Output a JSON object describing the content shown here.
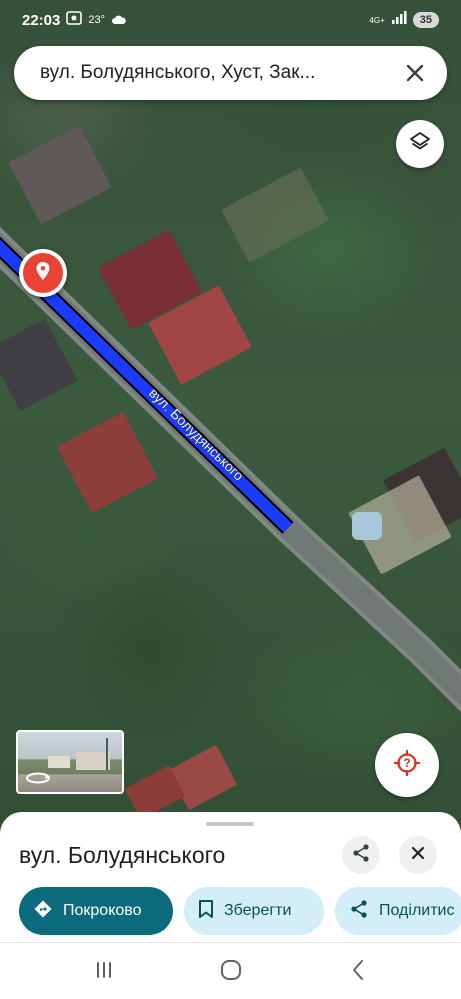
{
  "status_bar": {
    "time": "22:03",
    "temperature": "23°",
    "network": "4G+",
    "battery": "35"
  },
  "search": {
    "query": "вул. Болудянського, Хуст, Зак..."
  },
  "map": {
    "street_label": "вул. Болудянського",
    "route_color": "#1a3cff",
    "pin_color": "#ea4335"
  },
  "sheet": {
    "title": "вул. Болудянського",
    "actions": {
      "directions_label": "Покроково",
      "save_label": "Зберегти",
      "share_label": "Поділитис"
    }
  },
  "icons": {
    "layers": "layers-icon",
    "locate": "location-question-icon",
    "close": "close-icon",
    "share": "share-icon",
    "directions": "directions-icon",
    "bookmark": "bookmark-icon",
    "street_view": "street-view-thumbnail"
  }
}
